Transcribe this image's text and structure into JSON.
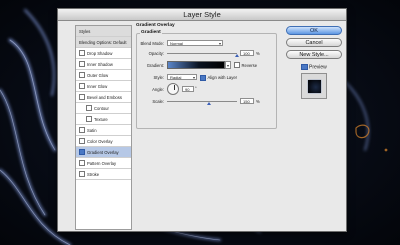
{
  "colors": {
    "background": "#06090f",
    "glow": "#6f86c9",
    "accent": "#4a78c4",
    "ok_button": "#5d97e3"
  },
  "dialog": {
    "title": "Layer Style"
  },
  "sidebar": {
    "items": [
      {
        "label": "Styles",
        "type": "header"
      },
      {
        "label": "Blending Options: Default",
        "type": "header"
      },
      {
        "label": "Drop Shadow",
        "checked": false
      },
      {
        "label": "Inner Shadow",
        "checked": false
      },
      {
        "label": "Outer Glow",
        "checked": false
      },
      {
        "label": "Inner Glow",
        "checked": false
      },
      {
        "label": "Bevel and Emboss",
        "checked": false
      },
      {
        "label": "Contour",
        "checked": false,
        "indent": true
      },
      {
        "label": "Texture",
        "checked": false,
        "indent": true
      },
      {
        "label": "Satin",
        "checked": false
      },
      {
        "label": "Color Overlay",
        "checked": false
      },
      {
        "label": "Gradient Overlay",
        "checked": true,
        "selected": true
      },
      {
        "label": "Pattern Overlay",
        "checked": false
      },
      {
        "label": "Stroke",
        "checked": false
      }
    ]
  },
  "panel": {
    "section_title": "Gradient Overlay",
    "group_title": "Gradient",
    "blend_mode_label": "Blend Mode:",
    "blend_mode_value": "Normal",
    "opacity_label": "Opacity:",
    "opacity_value": "100",
    "opacity_unit": "%",
    "opacity_fraction": 1.0,
    "gradient_label": "Gradient:",
    "reverse_label": "Reverse",
    "reverse_checked": false,
    "style_label": "Style:",
    "style_value": "Radial",
    "align_label": "Align with Layer",
    "align_checked": true,
    "angle_label": "Angle:",
    "angle_value": "90",
    "angle_unit": "°",
    "scale_label": "Scale:",
    "scale_value": "150",
    "scale_unit": "%",
    "scale_fraction": 0.6
  },
  "buttons": {
    "ok": "OK",
    "cancel": "Cancel",
    "new_style": "New Style...",
    "preview_label": "Preview",
    "preview_checked": true
  }
}
